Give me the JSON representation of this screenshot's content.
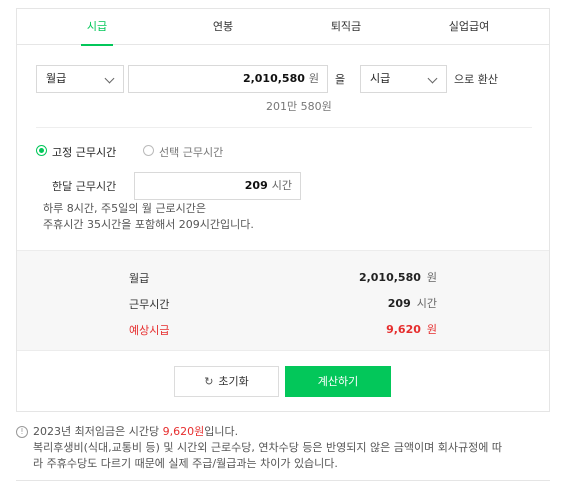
{
  "tabs": [
    {
      "label": "시급"
    },
    {
      "label": "연봉"
    },
    {
      "label": "퇴직금"
    },
    {
      "label": "실업급여"
    }
  ],
  "converter": {
    "from_unit": "월급",
    "amount": "2,010,580",
    "amount_unit": "원",
    "connector": "을",
    "to_unit": "시급",
    "suffix": "으로 환산",
    "amount_korean": "201만 580원"
  },
  "work_time": {
    "fixed_label": "고정 근무시간",
    "select_label": "선택 근무시간",
    "selected": "fixed",
    "monthly_label": "한달 근무시간",
    "monthly_hours": "209",
    "hours_unit": "시간",
    "desc_line1": "하루 8시간, 주5일의 월 근로시간은",
    "desc_line2": "주휴시간 35시간을 포함해서 209시간입니다."
  },
  "result": {
    "rows": [
      {
        "label": "월급",
        "value": "2,010,580",
        "unit": "원"
      },
      {
        "label": "근무시간",
        "value": "209",
        "unit": "시간"
      },
      {
        "label": "예상시급",
        "value": "9,620",
        "unit": "원"
      }
    ],
    "highlight_color": "#e62e2e"
  },
  "buttons": {
    "reset_label": "초기화",
    "calc_label": "계산하기"
  },
  "notice": {
    "pre": "2023년 최저임금은 시간당 ",
    "highlight": "9,620원",
    "post": "입니다.",
    "line2": "복리후생비(식대,교통비 등) 및 시간외 근로수당, 연차수당 등은 반영되지 않은 금액이며 회사규정에 따",
    "line3": "라 주휴수당도 다르기 때문에 실제 주급/월급과는 차이가 있습니다."
  },
  "colors": {
    "accent": "#03c75a",
    "warning": "#e62e2e"
  },
  "icons": {
    "select_chevron": "chevron-down-icon",
    "reset": "refresh-icon",
    "notice": "info-icon"
  }
}
